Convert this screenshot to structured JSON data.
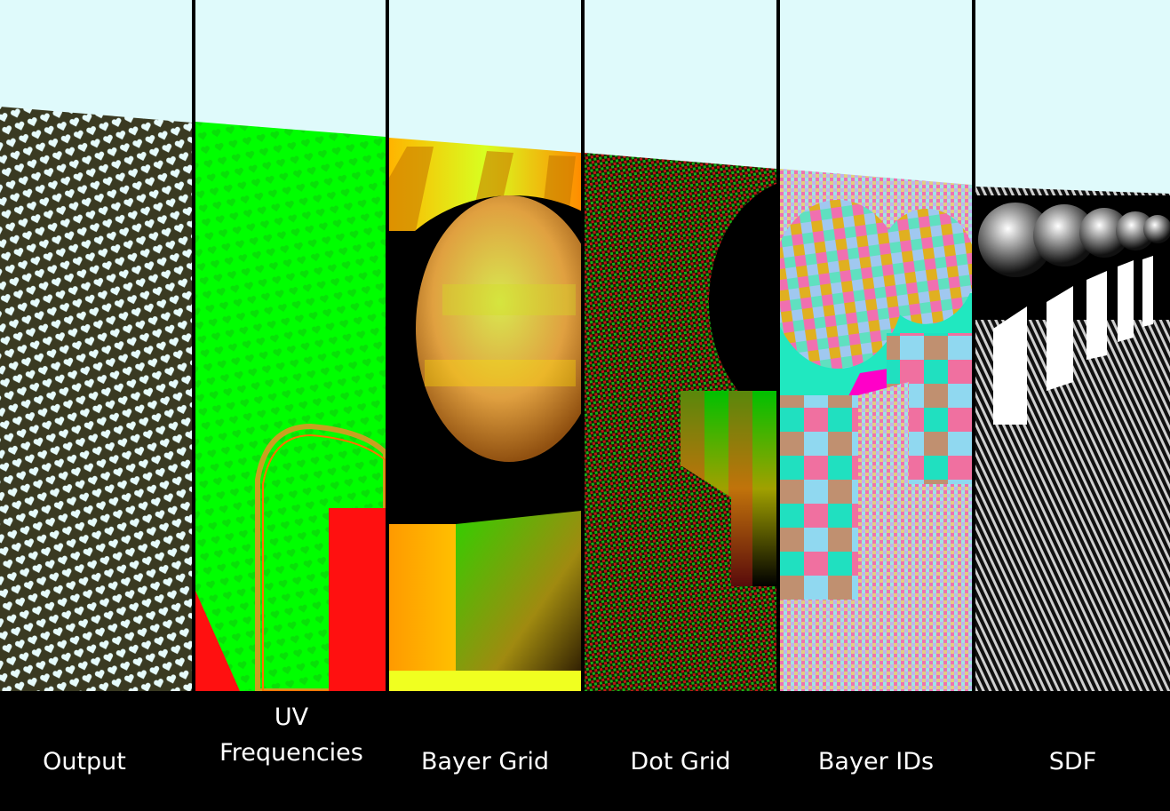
{
  "panels": [
    {
      "id": "output",
      "caption": "Output"
    },
    {
      "id": "uv",
      "caption_lines": [
        "UV",
        "Frequencies"
      ]
    },
    {
      "id": "bayer-grid",
      "caption": "Bayer Grid"
    },
    {
      "id": "dot-grid",
      "caption": "Dot Grid"
    },
    {
      "id": "bayer-ids",
      "caption": "Bayer IDs"
    },
    {
      "id": "sdf",
      "caption": "SDF"
    }
  ],
  "colors": {
    "sky": "#dffafb",
    "background": "#000000",
    "output_dark": "#3a3a22",
    "output_dot": "#e6fbfb",
    "uv_green": "#00ff00",
    "uv_red": "#ff1010",
    "bayer_orange": "#ff9a00",
    "bayer_yellow": "#f0ff20",
    "ids_pink": "#ff00c8",
    "ids_teal": "#20e8c0",
    "caption_text": "#ffffff"
  }
}
